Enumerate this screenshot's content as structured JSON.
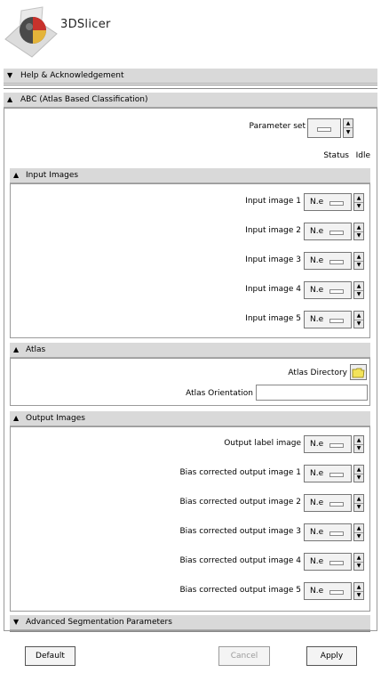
{
  "app": {
    "title": "3DSlicer"
  },
  "sections": {
    "help": {
      "label": "Help & Acknowledgement",
      "collapsed": true
    },
    "module": {
      "label": "ABC (Atlas Based Classification)",
      "collapsed": false
    },
    "advanced": {
      "label": "Advanced Segmentation Parameters",
      "collapsed": true
    }
  },
  "parameter_set": {
    "label": "Parameter set"
  },
  "status": {
    "label": "Status",
    "value": "Idle"
  },
  "input_images": {
    "label": "Input Images",
    "rows": [
      {
        "label": "Input image 1",
        "value": "N.e"
      },
      {
        "label": "Input image 2",
        "value": "N.e"
      },
      {
        "label": "Input image 3",
        "value": "N.e"
      },
      {
        "label": "Input image 4",
        "value": "N.e"
      },
      {
        "label": "Input image 5",
        "value": "N.e"
      }
    ]
  },
  "atlas": {
    "label": "Atlas",
    "directory_label": "Atlas Directory",
    "orientation_label": "Atlas Orientation",
    "orientation_value": ""
  },
  "output_images": {
    "label": "Output Images",
    "rows": [
      {
        "label": "Output label image",
        "value": "N.e"
      },
      {
        "label": "Bias corrected output image 1",
        "value": "N.e"
      },
      {
        "label": "Bias corrected output image 2",
        "value": "N.e"
      },
      {
        "label": "Bias corrected output image 3",
        "value": "N.e"
      },
      {
        "label": "Bias corrected output image 4",
        "value": "N.e"
      },
      {
        "label": "Bias corrected output image 5",
        "value": "N.e"
      }
    ]
  },
  "buttons": {
    "default": "Default",
    "cancel": "Cancel",
    "apply": "Apply"
  },
  "colors": {
    "section_bar": "#d9d9d9",
    "folder_icon": "#f2e35a"
  },
  "icons": {
    "collapsed": "triangle-down-icon",
    "expanded": "triangle-up-icon",
    "folder": "folder-icon",
    "logo": "slicer-logo-icon"
  }
}
